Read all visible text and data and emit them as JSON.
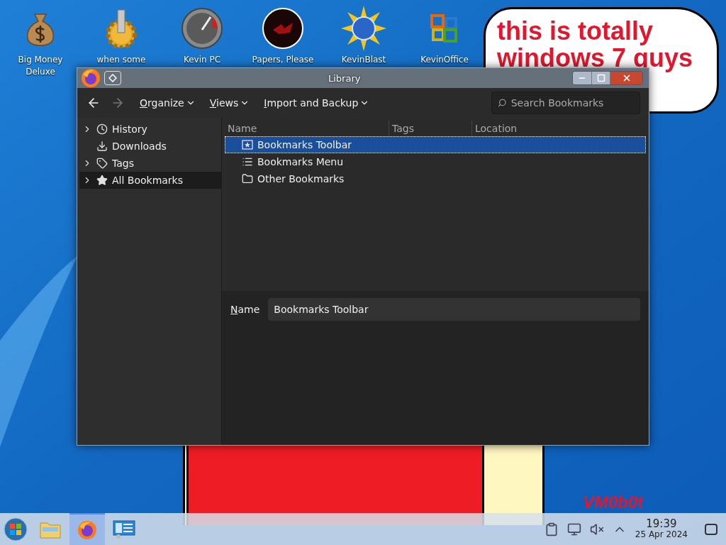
{
  "desktop_icons": [
    {
      "kind": "moneybag",
      "label": "Big Money Deluxe"
    },
    {
      "kind": "gear",
      "label": "when some"
    },
    {
      "kind": "gauge",
      "label": "Kevin PC"
    },
    {
      "kind": "disc",
      "label": "Papers, Please"
    },
    {
      "kind": "sun",
      "label": "KevinBlast"
    },
    {
      "kind": "office",
      "label": "KevinOffice"
    }
  ],
  "speech_bubble": {
    "lines": [
      "this is totally",
      "windows 7 guys"
    ]
  },
  "signature": "VM0b0t",
  "window": {
    "title": "Library",
    "toolbar": {
      "back_enabled": true,
      "forward_enabled": false,
      "menus": [
        {
          "label": "Organize"
        },
        {
          "label": "Views"
        },
        {
          "label": "Import and Backup"
        }
      ],
      "search": {
        "placeholder": "Search Bookmarks"
      }
    },
    "sidebar": {
      "items": [
        {
          "kind": "history",
          "label": "History",
          "expandable": true,
          "selected": false
        },
        {
          "kind": "downloads",
          "label": "Downloads",
          "expandable": false,
          "selected": false
        },
        {
          "kind": "tags",
          "label": "Tags",
          "expandable": true,
          "selected": false
        },
        {
          "kind": "star",
          "label": "All Bookmarks",
          "expandable": true,
          "selected": true
        }
      ]
    },
    "table": {
      "columns": [
        "Name",
        "Tags",
        "Location"
      ],
      "rows": [
        {
          "kind": "toolbar",
          "name": "Bookmarks Toolbar",
          "selected": true
        },
        {
          "kind": "menu",
          "name": "Bookmarks Menu",
          "selected": false
        },
        {
          "kind": "folder",
          "name": "Other Bookmarks",
          "selected": false
        }
      ]
    },
    "details": {
      "label": "Name",
      "value": "Bookmarks Toolbar"
    }
  },
  "taskbar": {
    "apps": [
      {
        "kind": "files",
        "active": false
      },
      {
        "kind": "firefox",
        "active": true
      },
      {
        "kind": "panel",
        "active": false
      }
    ],
    "clock": {
      "time": "19:39",
      "date": "25 Apr 2024"
    }
  }
}
